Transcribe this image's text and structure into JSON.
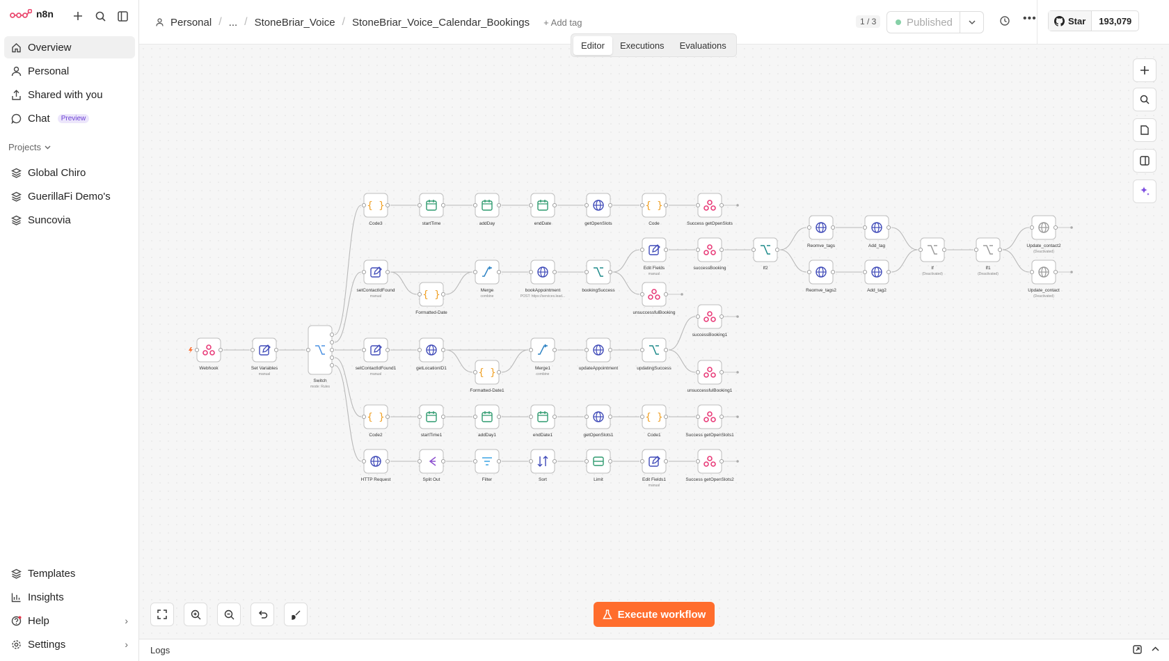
{
  "app": {
    "name": "n8n"
  },
  "sidebar": {
    "items": [
      {
        "label": "Overview",
        "icon": "home-icon",
        "active": true
      },
      {
        "label": "Personal",
        "icon": "user-icon"
      },
      {
        "label": "Shared with you",
        "icon": "share-icon"
      },
      {
        "label": "Chat",
        "icon": "chat-icon",
        "badge": "Preview"
      }
    ],
    "projects_title": "Projects",
    "projects": [
      {
        "label": "Global Chiro"
      },
      {
        "label": "GuerillaFi Demo's"
      },
      {
        "label": "Suncovia"
      }
    ],
    "bottom": [
      {
        "label": "Templates",
        "icon": "templates-icon"
      },
      {
        "label": "Insights",
        "icon": "insights-icon"
      },
      {
        "label": "Help",
        "icon": "help-icon"
      },
      {
        "label": "Settings",
        "icon": "settings-icon"
      }
    ]
  },
  "header": {
    "breadcrumbs": [
      "Personal",
      "...",
      "StoneBriar_Voice",
      "StoneBriar_Voice_Calendar_Bookings"
    ],
    "add_tag": "+ Add tag",
    "pager": "1 / 3",
    "publish_label": "Published",
    "github_star": "Star",
    "github_count": "193,079"
  },
  "tabs": [
    "Editor",
    "Executions",
    "Evaluations"
  ],
  "active_tab": "Editor",
  "nodes": [
    {
      "id": "webhook",
      "label": "Webhook",
      "icon": "webhook"
    },
    {
      "id": "setvars",
      "label": "Set Variables",
      "sub": "manual",
      "icon": "edit"
    },
    {
      "id": "switch",
      "label": "Switch",
      "sub": "mode: Rules",
      "icon": "switch"
    },
    {
      "id": "code3",
      "label": "Code3",
      "icon": "code"
    },
    {
      "id": "start",
      "label": "startTime",
      "icon": "date"
    },
    {
      "id": "addday",
      "label": "addDay",
      "icon": "date"
    },
    {
      "id": "enddate",
      "label": "endDate",
      "icon": "date"
    },
    {
      "id": "getopen",
      "label": "getOpenSlots",
      "icon": "http"
    },
    {
      "id": "code",
      "label": "Code",
      "icon": "code"
    },
    {
      "id": "succopen",
      "label": "Success getOpenSlots",
      "icon": "webhook"
    },
    {
      "id": "setcid",
      "label": "setContactIdFound",
      "sub": "manual",
      "icon": "edit"
    },
    {
      "id": "fdate",
      "label": "Formatted-Date",
      "icon": "code"
    },
    {
      "id": "merge",
      "label": "Merge",
      "sub": "combine",
      "icon": "merge"
    },
    {
      "id": "bookapp",
      "label": "bookAppointment",
      "sub": "POST: https://services.lead...",
      "icon": "http"
    },
    {
      "id": "booksucc",
      "label": "bookingSuccess",
      "icon": "if"
    },
    {
      "id": "editf",
      "label": "Edit Fields",
      "sub": "manual",
      "icon": "edit"
    },
    {
      "id": "succbook",
      "label": "successBooking",
      "icon": "webhook"
    },
    {
      "id": "unsucc",
      "label": "unsuccessfulBooking",
      "icon": "webhook"
    },
    {
      "id": "if2",
      "label": "If2",
      "icon": "if"
    },
    {
      "id": "remtags",
      "label": "Reomve_tags",
      "icon": "http"
    },
    {
      "id": "addtag",
      "label": "Add_tag",
      "icon": "http"
    },
    {
      "id": "remtags2",
      "label": "Reomve_tags2",
      "icon": "http"
    },
    {
      "id": "addtag2",
      "label": "Add_tag2",
      "icon": "http"
    },
    {
      "id": "if",
      "label": "If",
      "sub": "(Deactivated)",
      "icon": "if",
      "deact": true
    },
    {
      "id": "if1",
      "label": "If1",
      "sub": "(Deactivated)",
      "icon": "if",
      "deact": true
    },
    {
      "id": "updc2",
      "label": "Update_contact2",
      "sub": "(Deactivated)",
      "icon": "http",
      "deact": true
    },
    {
      "id": "updc",
      "label": "Update_contact",
      "sub": "(Deactivated)",
      "icon": "http",
      "deact": true
    },
    {
      "id": "setcid1",
      "label": "setContactIdFound1",
      "sub": "manual",
      "icon": "edit"
    },
    {
      "id": "getloc",
      "label": "getLocationID1",
      "icon": "http"
    },
    {
      "id": "fdate1",
      "label": "Formatted-Date1",
      "icon": "code"
    },
    {
      "id": "merge1",
      "label": "Merge1",
      "sub": "combine",
      "icon": "merge"
    },
    {
      "id": "updapp",
      "label": "updateAppointment",
      "icon": "http"
    },
    {
      "id": "updsucc",
      "label": "updatingSuccess",
      "icon": "if"
    },
    {
      "id": "succbook1",
      "label": "successBooking1",
      "icon": "webhook"
    },
    {
      "id": "unsucc1",
      "label": "unsuccessfulBooking1",
      "icon": "webhook"
    },
    {
      "id": "code2",
      "label": "Code2",
      "icon": "code"
    },
    {
      "id": "start1",
      "label": "startTime1",
      "icon": "date"
    },
    {
      "id": "addday1",
      "label": "addDay1",
      "icon": "date"
    },
    {
      "id": "enddate1",
      "label": "endDate1",
      "icon": "date"
    },
    {
      "id": "getopen1",
      "label": "getOpenSlots1",
      "icon": "http"
    },
    {
      "id": "code1",
      "label": "Code1",
      "icon": "code"
    },
    {
      "id": "succopen1",
      "label": "Success getOpenSlots1",
      "icon": "webhook"
    },
    {
      "id": "httpreq",
      "label": "HTTP Request",
      "icon": "http"
    },
    {
      "id": "splitout",
      "label": "Split Out",
      "icon": "split"
    },
    {
      "id": "filter",
      "label": "Filter",
      "icon": "filter"
    },
    {
      "id": "sort",
      "label": "Sort",
      "icon": "sort"
    },
    {
      "id": "limit",
      "label": "Limit",
      "icon": "limit"
    },
    {
      "id": "editf1",
      "label": "Edit Fields1",
      "sub": "manual",
      "icon": "edit"
    },
    {
      "id": "succopen2",
      "label": "Success getOpenSlots2",
      "icon": "webhook"
    }
  ],
  "connections": [
    [
      "webhook",
      "setvars"
    ],
    [
      "setvars",
      "switch"
    ],
    [
      "switch",
      "code3"
    ],
    [
      "switch",
      "setcid"
    ],
    [
      "switch",
      "setcid1"
    ],
    [
      "switch",
      "code2"
    ],
    [
      "switch",
      "httpreq"
    ],
    [
      "code3",
      "start"
    ],
    [
      "start",
      "addday"
    ],
    [
      "addday",
      "enddate"
    ],
    [
      "enddate",
      "getopen"
    ],
    [
      "getopen",
      "code"
    ],
    [
      "code",
      "succopen"
    ],
    [
      "setcid",
      "merge"
    ],
    [
      "setcid",
      "fdate"
    ],
    [
      "fdate",
      "merge"
    ],
    [
      "merge",
      "bookapp"
    ],
    [
      "bookapp",
      "booksucc"
    ],
    [
      "booksucc",
      "editf"
    ],
    [
      "booksucc",
      "unsucc"
    ],
    [
      "editf",
      "succbook"
    ],
    [
      "succbook",
      "if2"
    ],
    [
      "if2",
      "remtags"
    ],
    [
      "if2",
      "remtags2"
    ],
    [
      "remtags",
      "addtag"
    ],
    [
      "remtags2",
      "addtag2"
    ],
    [
      "addtag",
      "if"
    ],
    [
      "addtag2",
      "if"
    ],
    [
      "if",
      "if1"
    ],
    [
      "if1",
      "updc2"
    ],
    [
      "if1",
      "updc"
    ],
    [
      "setcid1",
      "getloc"
    ],
    [
      "getloc",
      "merge1"
    ],
    [
      "getloc",
      "fdate1"
    ],
    [
      "fdate1",
      "merge1"
    ],
    [
      "merge1",
      "updapp"
    ],
    [
      "updapp",
      "updsucc"
    ],
    [
      "updsucc",
      "succbook1"
    ],
    [
      "updsucc",
      "unsucc1"
    ],
    [
      "code2",
      "start1"
    ],
    [
      "start1",
      "addday1"
    ],
    [
      "addday1",
      "enddate1"
    ],
    [
      "enddate1",
      "getopen1"
    ],
    [
      "getopen1",
      "code1"
    ],
    [
      "code1",
      "succopen1"
    ],
    [
      "httpreq",
      "splitout"
    ],
    [
      "splitout",
      "filter"
    ],
    [
      "filter",
      "sort"
    ],
    [
      "sort",
      "limit"
    ],
    [
      "limit",
      "editf1"
    ],
    [
      "editf1",
      "succopen2"
    ]
  ],
  "execute_label": "Execute workflow",
  "logs_label": "Logs",
  "colors": {
    "accent": "#ff6d2d",
    "webhook": "#e83c79",
    "http": "#3f4ab8",
    "code": "#f0a024",
    "date": "#2d9a6e",
    "switch": "#4a90e2",
    "if": "#1d8a8a",
    "merge": "#2e83c4",
    "split": "#8c4fcf"
  }
}
